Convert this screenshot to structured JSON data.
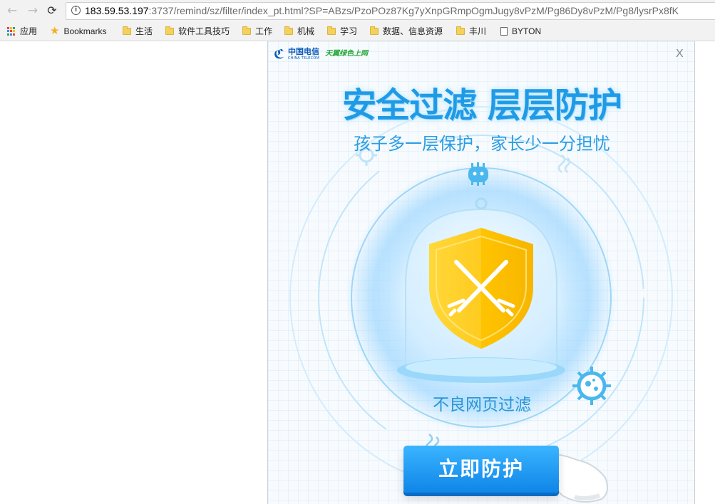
{
  "browser": {
    "url_host": "183.59.53.197",
    "url_rest": ":3737/remind/sz/filter/index_pt.html?SP=ABzs/PzoPOz87Kg7yXnpGRmpOgmJugy8vPzM/Pg86Dy8vPzM/Pg8/lysrPx8fK",
    "icons": {
      "back": "back-arrow-icon",
      "forward": "forward-arrow-icon",
      "reload": "reload-icon",
      "info": "info-icon"
    }
  },
  "bookmarks": [
    {
      "label": "应用",
      "icon": "apps-grid-icon"
    },
    {
      "label": "Bookmarks",
      "icon": "star-icon"
    },
    {
      "label": "生活",
      "icon": "folder-icon"
    },
    {
      "label": "软件工具技巧",
      "icon": "folder-icon"
    },
    {
      "label": "工作",
      "icon": "folder-icon"
    },
    {
      "label": "机械",
      "icon": "folder-icon"
    },
    {
      "label": "学习",
      "icon": "folder-icon"
    },
    {
      "label": "数据、信息资源",
      "icon": "folder-icon"
    },
    {
      "label": "丰川",
      "icon": "folder-icon"
    },
    {
      "label": "BYTON",
      "icon": "page-icon"
    }
  ],
  "popup": {
    "logo_cn": "中国电信",
    "logo_en": "CHINA TELECOM",
    "logo_partner": "天翼绿色上网",
    "close_label": "X",
    "headline": "安全过滤 层层防护",
    "subline": "孩子多一层保护，家长少一分担忧",
    "caption": "不良网页过滤",
    "cta_label": "立即防护",
    "colors": {
      "brand_blue": "#1f9be6",
      "cta_blue": "#0f86e8",
      "shield_gold": "#ffc61a"
    }
  }
}
